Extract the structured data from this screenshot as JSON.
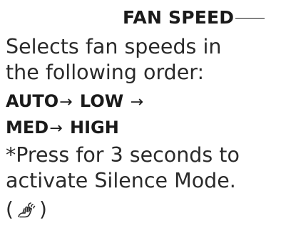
{
  "heading": "FAN SPEED",
  "description": {
    "line1": "Selects fan speeds in",
    "line2": "the following order:"
  },
  "sequence": {
    "step1": "AUTO",
    "step2": "LOW",
    "step3": "MED",
    "step4": "HIGH",
    "arrow": "→"
  },
  "note": {
    "line1": "*Press for 3 seconds to",
    "line2": "activate Silence Mode."
  },
  "silence_icon": {
    "open_paren": "(",
    "close_paren": ")",
    "icon_name": "silence-mode-hand-icon"
  }
}
